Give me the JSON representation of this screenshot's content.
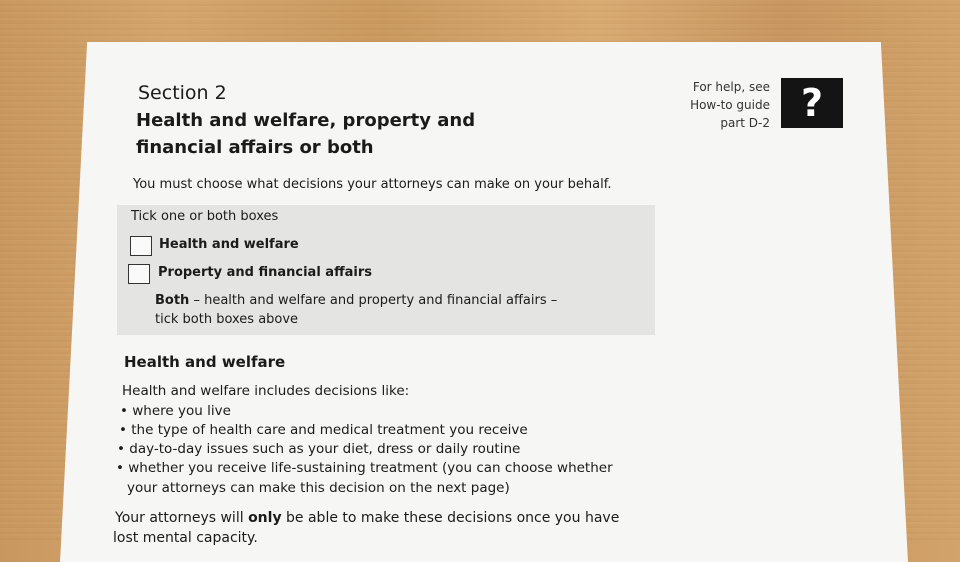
{
  "form": {
    "section_label": "Section 2",
    "title_line1": "Health and welfare, property and",
    "title_line2": "financial affairs or both",
    "help_line1": "For help, see",
    "help_line2": "How-to guide",
    "help_line3": "part D-2",
    "help_symbol": "?",
    "intro": "You must choose what decisions your attorneys can make on your behalf.",
    "tick_instruction": "Tick one or both boxes",
    "option_health": "Health and welfare",
    "option_property": "Property and financial affairs",
    "both_bold": "Both",
    "both_line1_rest": " – health and welfare and property and financial affairs –",
    "both_line2": "tick both boxes above",
    "hw_heading": "Health and welfare",
    "hw_intro": "Health and welfare includes decisions like:",
    "bullets": [
      "where you live",
      "the type of health care and medical treatment you receive",
      "day-to-day issues such as your diet, dress or daily routine",
      "whether you receive life-sustaining treatment (you can choose whether"
    ],
    "bullet4_cont": "your attorneys can make this decision on the next page)",
    "only_pre": "Your attorneys will ",
    "only_bold": "only",
    "only_post": " be able to make these decisions once you have",
    "last_line": "lost mental capacity."
  }
}
